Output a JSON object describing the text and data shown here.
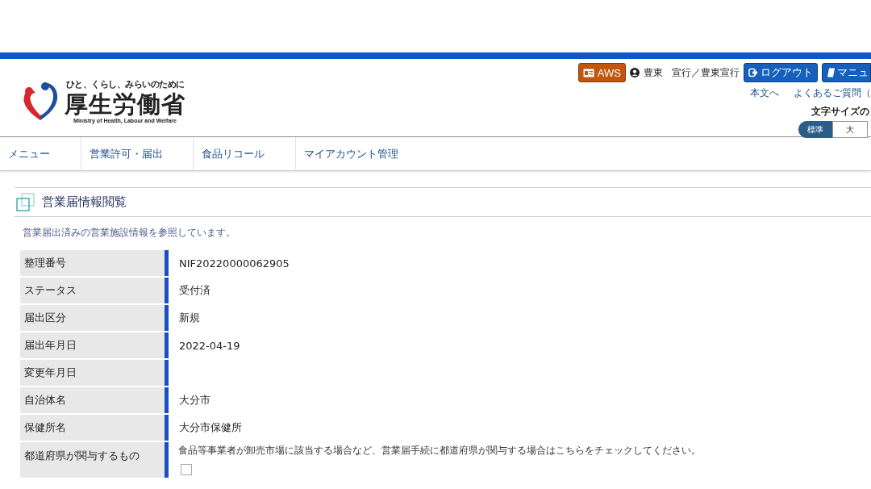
{
  "header": {
    "tagline": "ひと、くらし、みらいのために",
    "logo_name": "厚生労働省",
    "logo_english": "Ministry of Health, Labour and Welfare",
    "aws_button": "AWS",
    "user_name": "豊東",
    "user_org": "宣行／豊東宣行",
    "logout_button": "ログアウト",
    "manual_button": "マニュ",
    "links": [
      "本文へ",
      "よくあるご質問（"
    ],
    "font_size_label": "文字サイズの",
    "font_sizes": [
      {
        "label": "標準",
        "selected": true
      },
      {
        "label": "大",
        "selected": false
      }
    ]
  },
  "nav": [
    {
      "label": "メニュー"
    },
    {
      "label": "営業許可・届出"
    },
    {
      "label": "食品リコール"
    },
    {
      "label": "マイアカウント管理"
    }
  ],
  "page": {
    "title": "営業届情報閲覧",
    "description": "営業届出済みの営業施設情報を参照しています。"
  },
  "fields": [
    {
      "kind": "text",
      "label": "整理番号",
      "value": "NIF20220000062905"
    },
    {
      "kind": "text",
      "label": "ステータス",
      "value": "受付済"
    },
    {
      "kind": "text",
      "label": "届出区分",
      "value": "新規"
    },
    {
      "kind": "text",
      "label": "届出年月日",
      "value": "2022-04-19"
    },
    {
      "kind": "text",
      "label": "変更年月日"
    },
    {
      "kind": "text",
      "label": "自治体名",
      "value": "大分市"
    },
    {
      "kind": "text",
      "label": "保健所名",
      "value": "大分市保健所"
    },
    {
      "kind": "checkbox",
      "label": "都道府県が関与するもの",
      "note": "食品等事業者が卸売市場に該当する場合など、営業届手続に都道府県が関与する場合はこちらをチェックしてください。",
      "checked": false
    }
  ]
}
